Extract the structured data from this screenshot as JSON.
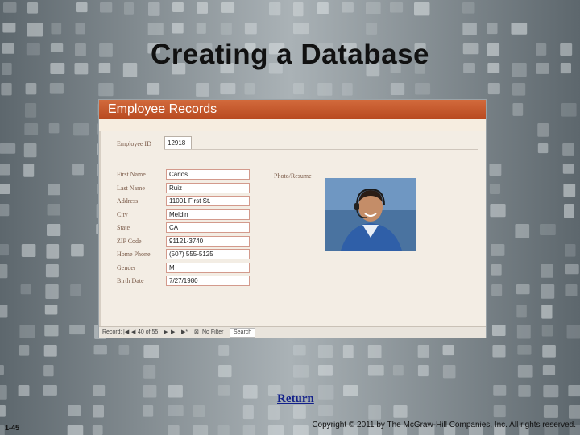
{
  "slide": {
    "title": "Creating a Database",
    "return_label": "Return",
    "page_number": "1-45",
    "copyright": "Copyright © 2011 by The McGraw-Hill Companies, Inc. All rights reserved."
  },
  "form": {
    "header": "Employee Records",
    "employee_id_label": "Employee ID",
    "employee_id_value": "12918",
    "photo_label": "Photo/Resume",
    "fields": [
      {
        "label": "First Name",
        "value": "Carlos"
      },
      {
        "label": "Last Name",
        "value": "Ruiz"
      },
      {
        "label": "Address",
        "value": "11001 First St."
      },
      {
        "label": "City",
        "value": "Meldin"
      },
      {
        "label": "State",
        "value": "CA"
      },
      {
        "label": "ZIP Code",
        "value": "91121-3740"
      },
      {
        "label": "Home Phone",
        "value": "(507) 555-5125"
      },
      {
        "label": "Gender",
        "value": "M"
      },
      {
        "label": "Birth Date",
        "value": "7/27/1980"
      }
    ]
  },
  "statusbar": {
    "record_label": "Record:",
    "first_icon": "first-record-icon",
    "prev_icon": "prev-record-icon",
    "position": "40 of 55",
    "next_icon": "next-record-icon",
    "last_icon": "last-record-icon",
    "filter_label": "No Filter",
    "search_label": "Search"
  },
  "colors": {
    "header": "#c4562c",
    "form_bg": "#f3ede4",
    "link": "#12208a"
  }
}
